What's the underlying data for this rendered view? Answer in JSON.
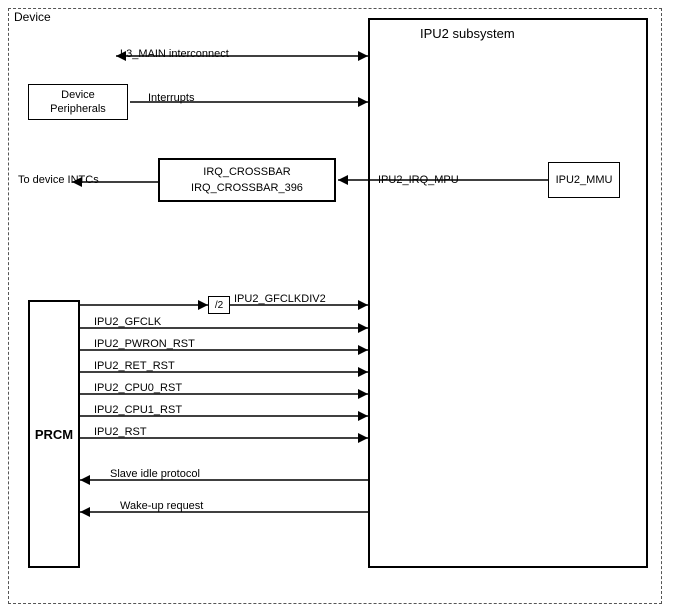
{
  "diagram": {
    "title": "Device",
    "device_label": "Device",
    "ipu2_label": "IPU2 subsystem",
    "l3_label": "L3_MAIN interconnect",
    "dev_periph_label": "Device\nPeripherals",
    "interrupts_label": "Interrupts",
    "to_intcs_label": "To device INTCs",
    "irq_crossbar_line1": "IRQ_CROSSBAR",
    "irq_crossbar_line2": "IRQ_CROSSBAR_396",
    "ipu2_irq_mpu_label": "IPU2_IRQ_MPU",
    "ipu2_mmu_label": "IPU2_MMU",
    "prcm_label": "PRCM",
    "clk_div_label": "/2",
    "signals": [
      "IPU2_GFCLKDIV2",
      "IPU2_GFCLK",
      "IPU2_PWRON_RST",
      "IPU2_RET_RST",
      "IPU2_CPU0_RST",
      "IPU2_CPU1_RST",
      "IPU2_RST",
      "Slave idle protocol",
      "Wake-up request"
    ]
  }
}
